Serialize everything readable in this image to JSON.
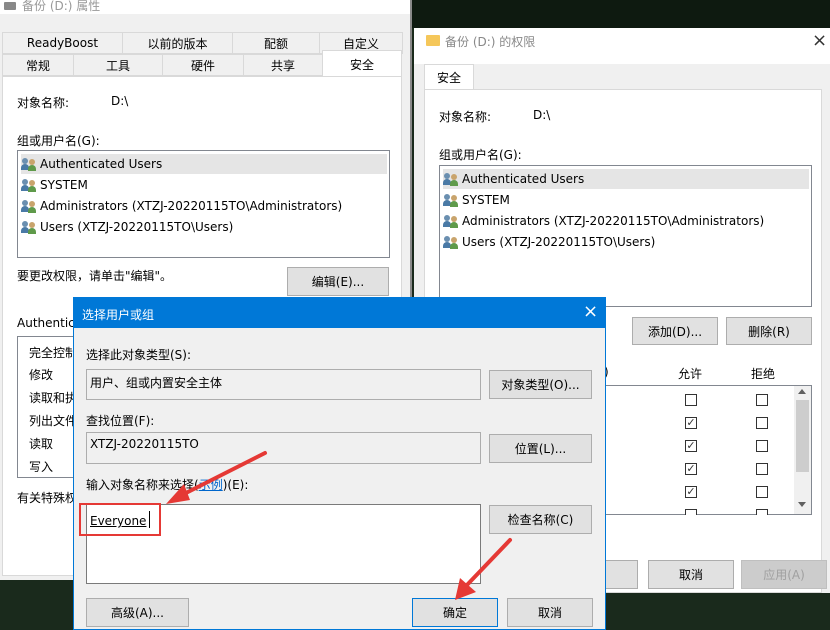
{
  "props": {
    "title": "备份 (D:) 属性",
    "tabs_row1": [
      "ReadyBoost",
      "以前的版本",
      "配额",
      "自定义"
    ],
    "tabs_row2": [
      "常规",
      "工具",
      "硬件",
      "共享",
      "安全"
    ],
    "object_label": "对象名称:",
    "object_value": "D:\\",
    "group_label": "组或用户名(G):",
    "users": [
      "Authenticated Users",
      "SYSTEM",
      "Administrators (XTZJ-20220115TO\\Administrators)",
      "Users (XTZJ-20220115TO\\Users)"
    ],
    "change_hint": "要更改权限，请单击\"编辑\"。",
    "edit_button": "编辑(E)...",
    "perm_header": "Authentica",
    "perm_items": [
      "完全控制",
      "修改",
      "读取和执",
      "列出文件",
      "读取",
      "写入"
    ],
    "special_hint": "有关特殊权"
  },
  "perm": {
    "title": "备份 (D:) 的权限",
    "close": "×",
    "tab": "安全",
    "object_label": "对象名称:",
    "object_value": "D:\\",
    "group_label": "组或用户名(G):",
    "users": [
      "Authenticated Users",
      "SYSTEM",
      "Administrators (XTZJ-20220115TO\\Administrators)",
      "Users (XTZJ-20220115TO\\Users)"
    ],
    "add_button": "添加(D)...",
    "remove_button": "删除(R)",
    "perm_paren": ")",
    "allow_label": "允许",
    "deny_label": "拒绝",
    "allow_checks": [
      false,
      true,
      true,
      true,
      true,
      true
    ],
    "deny_checks": [
      false,
      false,
      false,
      false,
      false,
      false
    ],
    "cancel_button": "取消",
    "apply_button": "应用(A)"
  },
  "select": {
    "title": "选择用户或组",
    "close": "×",
    "type_label": "选择此对象类型(S):",
    "type_value": "用户、组或内置安全主体",
    "type_button": "对象类型(O)...",
    "location_label": "查找位置(F):",
    "location_value": "XTZJ-20220115TO",
    "location_button": "位置(L)...",
    "enter_label_pre": "输入对象名称来选择(",
    "enter_label_link": "示例",
    "enter_label_post": ")(E):",
    "name_value": "Everyone",
    "check_button": "检查名称(C)",
    "advanced_button": "高级(A)...",
    "ok_button": "确定",
    "cancel_button": "取消"
  },
  "colors": {
    "accent": "#0078d7",
    "annotation": "#e53935"
  }
}
